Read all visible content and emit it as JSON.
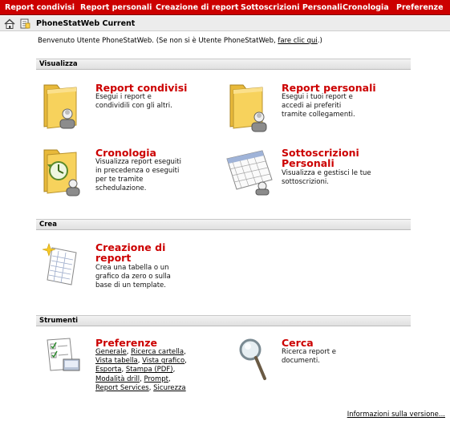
{
  "nav": {
    "tabs": [
      "Report condivisi",
      "Report personali",
      "Creazione di report",
      "Sottoscrizioni Personali",
      "Cronologia",
      "Preferenze"
    ]
  },
  "titlebar": {
    "title": "PhoneStatWeb Current"
  },
  "welcome": {
    "text": "Benvenuto Utente PhoneStatWeb. (Se non si è Utente PhoneStatWeb, ",
    "link": "fare clic qui",
    "suffix": ".)"
  },
  "sections": {
    "visualizza": "Visualizza",
    "crea": "Crea",
    "strumenti": "Strumenti"
  },
  "items": {
    "report_condivisi": {
      "title": "Report condivisi",
      "desc": "Esegui i report e condividili con gli altri."
    },
    "report_personali": {
      "title": "Report personali",
      "desc": "Esegui i tuoi report e accedi ai preferiti tramite collegamenti."
    },
    "cronologia": {
      "title": "Cronologia",
      "desc": "Visualizza report eseguiti in precedenza o eseguiti per te tramite schedulazione."
    },
    "sottoscrizioni": {
      "title": "Sottoscrizioni Personali",
      "desc": "Visualizza e gestisci le tue sottoscrizioni."
    },
    "creazione": {
      "title": "Creazione di report",
      "desc": "Crea una tabella o un grafico da zero o sulla base di un template."
    },
    "preferenze": {
      "title": "Preferenze"
    },
    "cerca": {
      "title": "Cerca",
      "desc": "Ricerca report e documenti."
    }
  },
  "preferenze_links": {
    "generale": "Generale",
    "ricerca_cartella": "Ricerca cartella",
    "vista_tabella": "Vista tabella",
    "vista_grafico": "Vista grafico",
    "esporta": "Esporta",
    "stampa_pdf": "Stampa (PDF)",
    "modalita_drill": "Modalità drill",
    "prompt": "Prompt",
    "report_services": "Report Services",
    "sicurezza": "Sicurezza"
  },
  "footer": {
    "version_link": "Informazioni sulla versione..."
  },
  "colors": {
    "nav_bg": "#cc0000",
    "title_red": "#cc0000",
    "folder": "#f5c842"
  }
}
